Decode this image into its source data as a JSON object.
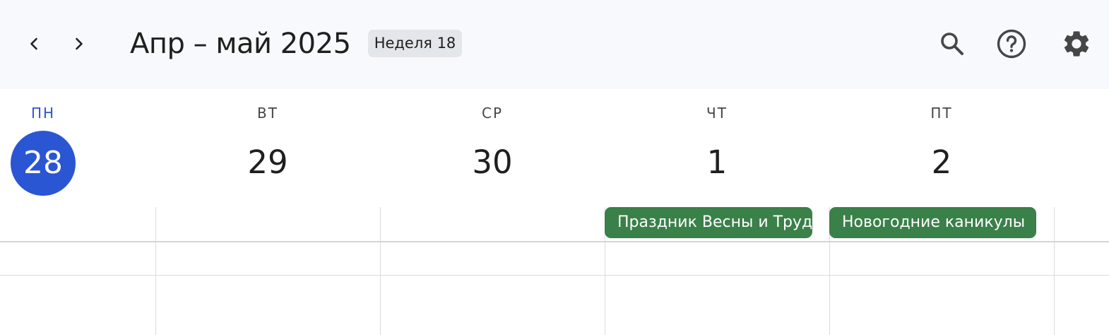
{
  "header": {
    "title": "Апр – май 2025",
    "week_badge": "Неделя 18",
    "prev_icon": "chevron-left-icon",
    "next_icon": "chevron-right-icon",
    "search_icon": "search-icon",
    "help_icon": "help-icon",
    "settings_icon": "gear-icon"
  },
  "days": [
    {
      "dow": "ПН",
      "date": "28",
      "today": true
    },
    {
      "dow": "ВТ",
      "date": "29"
    },
    {
      "dow": "СР",
      "date": "30"
    },
    {
      "dow": "ЧТ",
      "date": "1"
    },
    {
      "dow": "ПТ",
      "date": "2"
    }
  ],
  "events": [
    {
      "day": "ЧТ",
      "title": "Праздник Весны и Труда"
    },
    {
      "day": "ПТ",
      "title": "Новогодние каникулы"
    }
  ],
  "colors": {
    "accent": "#2a56d3",
    "event": "#3a8049",
    "topbar_bg": "#f8f9fc"
  }
}
